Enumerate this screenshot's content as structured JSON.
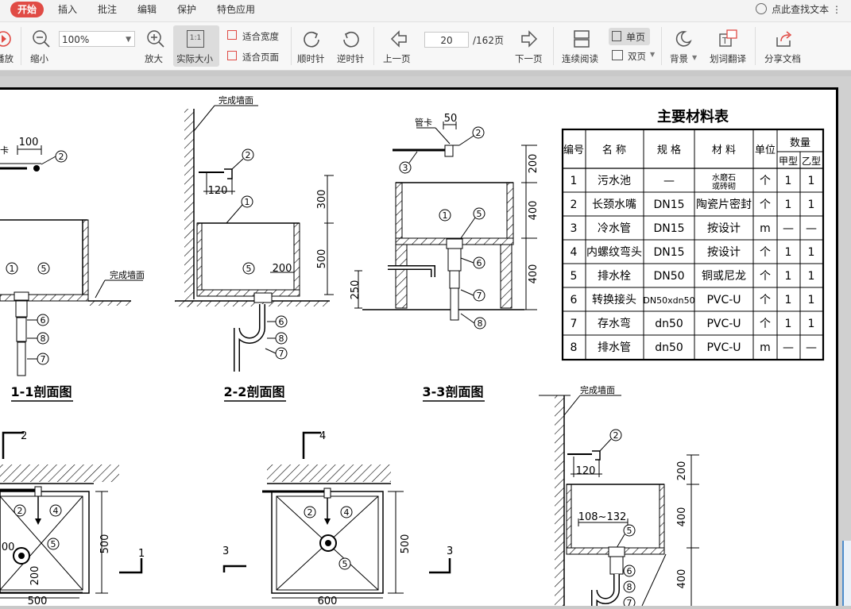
{
  "menu": {
    "items": [
      "开始",
      "插入",
      "批注",
      "编辑",
      "保护",
      "特色应用"
    ],
    "search_label": "点此查找文本"
  },
  "toolbar": {
    "play": "播放",
    "zoom_out": "缩小",
    "zoom_value": "100%",
    "zoom_in": "放大",
    "actual_size": "实际大小",
    "actual_size_icon_text": "1:1",
    "fit_width": "适合宽度",
    "fit_page": "适合页面",
    "rotate_cw": "顺时针",
    "rotate_ccw": "逆时针",
    "prev_page": "上一页",
    "page_current": "20",
    "page_total": "/162页",
    "next_page": "下一页",
    "continuous": "连续阅读",
    "single_page": "单页",
    "double_page": "双页",
    "background": "背景",
    "translate": "划词翻译",
    "share": "分享文档"
  },
  "drawing": {
    "table_title": "主要材料表",
    "table_headers": [
      "编号",
      "名 称",
      "规 格",
      "材 料",
      "单位",
      "数量",
      "甲型",
      "乙型"
    ],
    "table_rows": [
      [
        "1",
        "污水池",
        "—",
        "水磨石\n或砖砌",
        "个",
        "1",
        "1"
      ],
      [
        "2",
        "长颈水嘴",
        "DN15",
        "陶瓷片密封",
        "个",
        "1",
        "1"
      ],
      [
        "3",
        "冷水管",
        "DN15",
        "按设计",
        "m",
        "—",
        "—"
      ],
      [
        "4",
        "内螺纹弯头",
        "DN15",
        "按设计",
        "个",
        "1",
        "1"
      ],
      [
        "5",
        "排水栓",
        "DN50",
        "铜或尼龙",
        "个",
        "1",
        "1"
      ],
      [
        "6",
        "转换接头",
        "DN50xdn50",
        "PVC-U",
        "个",
        "1",
        "1"
      ],
      [
        "7",
        "存水弯",
        "dn50",
        "PVC-U",
        "个",
        "1",
        "1"
      ],
      [
        "8",
        "排水管",
        "dn50",
        "PVC-U",
        "m",
        "—",
        "—"
      ]
    ],
    "section_titles": [
      "1-1剖面图",
      "2-2剖面图",
      "3-3剖面图"
    ],
    "wall_label": "完成墙面",
    "pipe_clip_label": "管卡",
    "callouts": [
      "1",
      "2",
      "3",
      "4",
      "5",
      "6",
      "7",
      "8"
    ],
    "dims": {
      "d100": "100",
      "d50": "50",
      "d120": "120",
      "d200": "200",
      "d300": "300",
      "d400": "400",
      "d500": "500",
      "d250": "250",
      "d600": "600",
      "d108_132": "108~132"
    },
    "cut_marks": [
      "1",
      "2",
      "3",
      "4"
    ]
  }
}
